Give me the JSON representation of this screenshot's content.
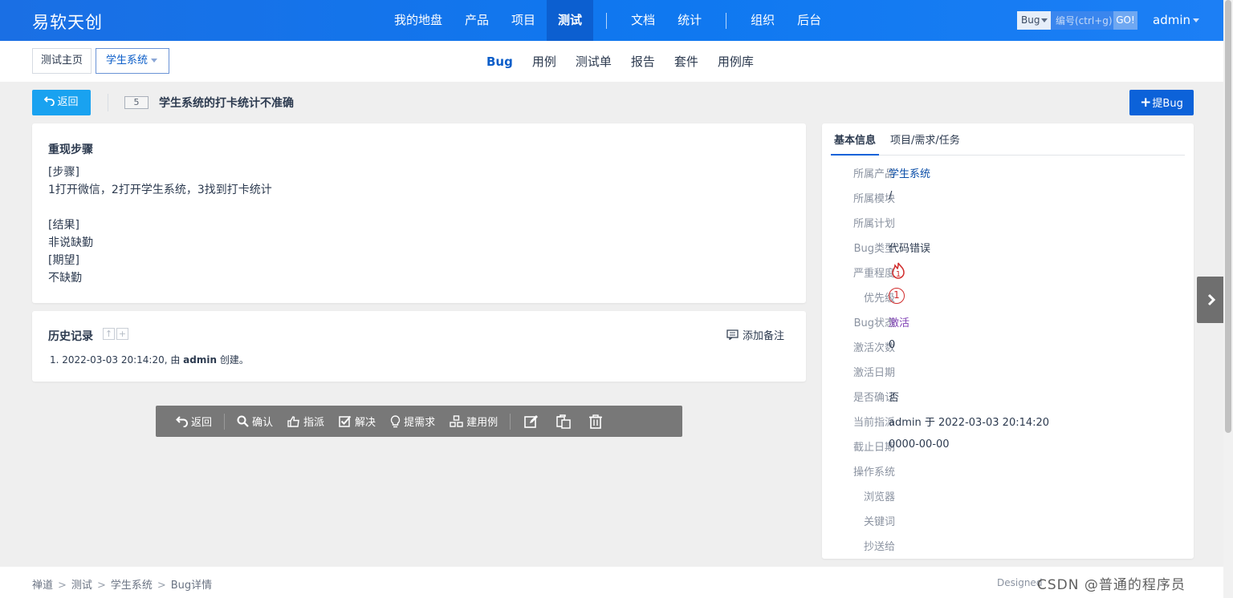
{
  "header": {
    "brand": "易软天创",
    "nav": [
      "我的地盘",
      "产品",
      "项目",
      "测试",
      "文档",
      "统计",
      "组织",
      "后台"
    ],
    "active_nav": "测试",
    "search_type": "Bug",
    "search_placeholder": "编号(ctrl+g)",
    "search_go": "GO!",
    "user": "admin"
  },
  "subnav": {
    "home": "测试主页",
    "product": "学生系统",
    "tabs": [
      "Bug",
      "用例",
      "测试单",
      "报告",
      "套件",
      "用例库"
    ],
    "active_tab": "Bug"
  },
  "toolbar": {
    "back_label": "返回",
    "bug_id": "5",
    "bug_title": "学生系统的打卡统计不准确",
    "new_bug_label": "提Bug"
  },
  "steps": {
    "title": "重现步骤",
    "lines": [
      "[步骤]",
      "1打开微信，2打开学生系统，3找到打卡统计",
      "",
      "[结果]",
      "非说缺勤",
      "[期望]",
      "不缺勤"
    ]
  },
  "history": {
    "title": "历史记录",
    "add_note": "添加备注",
    "entry_prefix": "1. 2022-03-03 20:14:20, 由 ",
    "entry_user": "admin",
    "entry_suffix": " 创建。"
  },
  "actions": {
    "back": "返回",
    "confirm": "确认",
    "assign": "指派",
    "resolve": "解决",
    "to_story": "提需求",
    "create_case": "建用例"
  },
  "side": {
    "tabs": [
      "基本信息",
      "项目/需求/任务"
    ],
    "fields": [
      {
        "label": "所属产品",
        "value": "学生系统"
      },
      {
        "label": "所属模块",
        "value": "/"
      },
      {
        "label": "所属计划",
        "value": ""
      },
      {
        "label": "Bug类型",
        "value": "代码错误"
      },
      {
        "label": "严重程度",
        "value": "1"
      },
      {
        "label": "优先级",
        "value": "1"
      },
      {
        "label": "Bug状态",
        "value": "激活"
      },
      {
        "label": "激活次数",
        "value": "0"
      },
      {
        "label": "激活日期",
        "value": ""
      },
      {
        "label": "是否确认",
        "value": "否"
      },
      {
        "label": "当前指派",
        "value": "admin 于 2022-03-03 20:14:20"
      },
      {
        "label": "截止日期",
        "value": "0000-00-00"
      },
      {
        "label": "操作系统",
        "value": ""
      },
      {
        "label": "浏览器",
        "value": ""
      },
      {
        "label": "关键词",
        "value": ""
      },
      {
        "label": "抄送给",
        "value": ""
      }
    ]
  },
  "footer": {
    "crumbs": [
      "禅道",
      "测试",
      "学生系统",
      "Bug详情"
    ],
    "designed": "Designed",
    "watermark": "CSDN @普通的程序员"
  },
  "colors": {
    "header_blue": "#1a6fe4",
    "primary": "#0c62d9",
    "back_button": "#19a2f0",
    "severity_red": "#d12c2c",
    "status_purple": "#7e3fb3"
  }
}
